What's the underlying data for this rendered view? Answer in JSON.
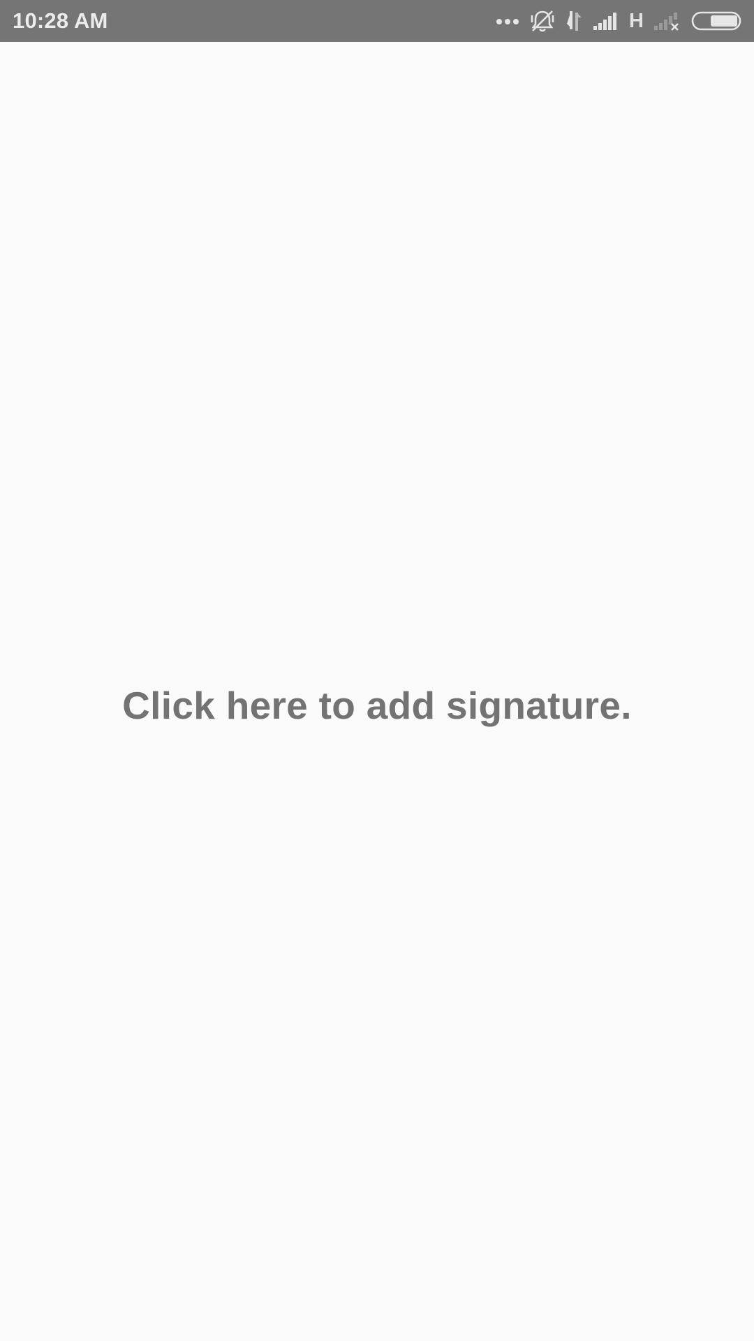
{
  "status_bar": {
    "time": "10:28 AM",
    "network_type": "H",
    "icons": [
      "more-notifications-icon",
      "alarm-off-icon",
      "data-transfer-icon",
      "signal-strength-icon",
      "no-signal-sim2-icon",
      "battery-icon"
    ]
  },
  "signature_pad": {
    "hint": "Click here to add signature."
  }
}
